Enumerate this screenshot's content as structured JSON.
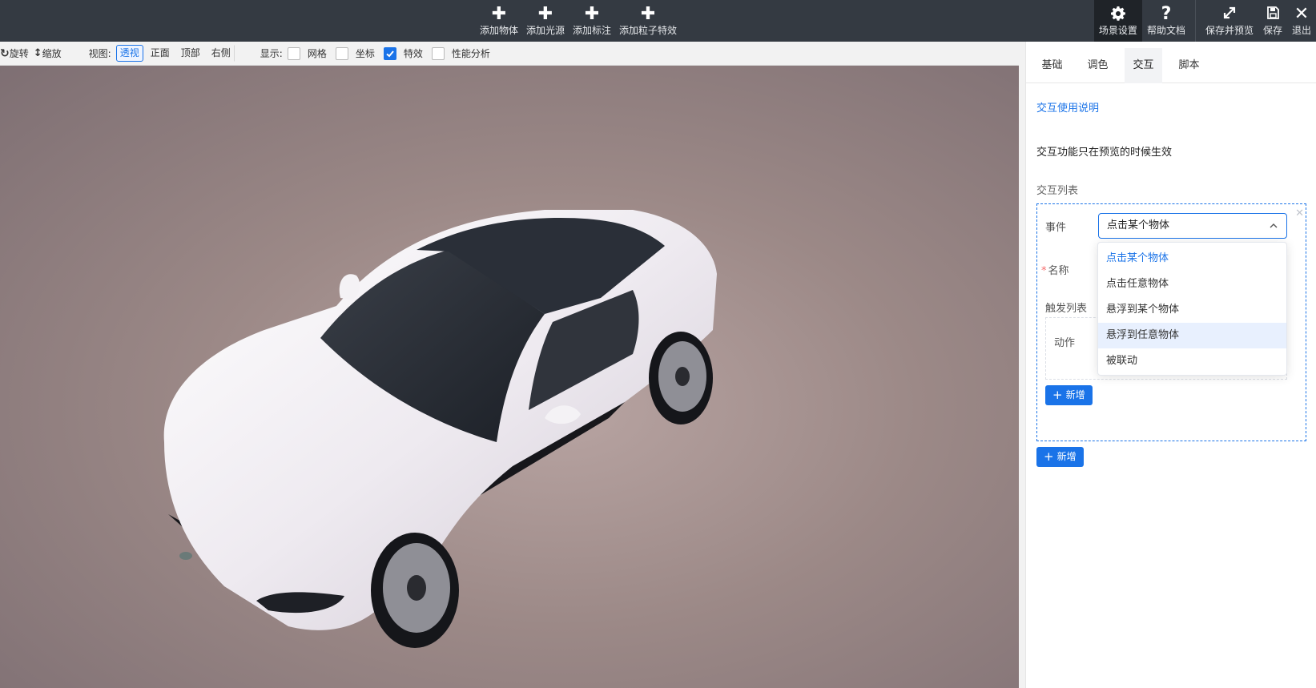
{
  "toolbar": {
    "center_items": [
      {
        "label": "添加物体",
        "icon": "plus-icon"
      },
      {
        "label": "添加光源",
        "icon": "plus-icon"
      },
      {
        "label": "添加标注",
        "icon": "plus-icon"
      },
      {
        "label": "添加粒子特效",
        "icon": "plus-icon"
      }
    ],
    "right_items": [
      {
        "label": "场景设置",
        "icon": "gear-icon",
        "active": true
      },
      {
        "label": "帮助文档",
        "icon": "question-icon"
      },
      {
        "label": "保存并预览",
        "icon": "expand-icon"
      },
      {
        "label": "保存",
        "icon": "save-icon"
      },
      {
        "label": "退出",
        "icon": "close-icon"
      }
    ]
  },
  "viewbar": {
    "rotate_label": "旋转",
    "zoom_label": "缩放",
    "view_label": "视图:",
    "view_options": [
      "透视",
      "正面",
      "顶部",
      "右侧"
    ],
    "active_view": "透视",
    "display_label": "显示:",
    "display_options": [
      {
        "label": "网格",
        "checked": false
      },
      {
        "label": "坐标",
        "checked": false
      },
      {
        "label": "特效",
        "checked": true
      },
      {
        "label": "性能分析",
        "checked": false
      }
    ]
  },
  "panel": {
    "tabs": [
      "基础",
      "调色",
      "交互",
      "脚本"
    ],
    "active_tab": "交互",
    "help_link": "交互使用说明",
    "note": "交互功能只在预览的时候生效",
    "list_title": "交互列表",
    "item": {
      "event_label": "事件",
      "event_value": "点击某个物体",
      "name_label": "名称",
      "trigger_label": "触发列表",
      "action_label": "动作",
      "add_label": "新增"
    },
    "add_label": "新增",
    "dropdown": {
      "options": [
        "点击某个物体",
        "点击任意物体",
        "悬浮到某个物体",
        "悬浮到任意物体",
        "被联动"
      ],
      "selected": "点击某个物体",
      "hovered": "悬浮到任意物体"
    }
  },
  "colors": {
    "accent": "#1a73e8",
    "toolbar_bg": "#343a42",
    "toolbar_active_bg": "#1f2328"
  }
}
